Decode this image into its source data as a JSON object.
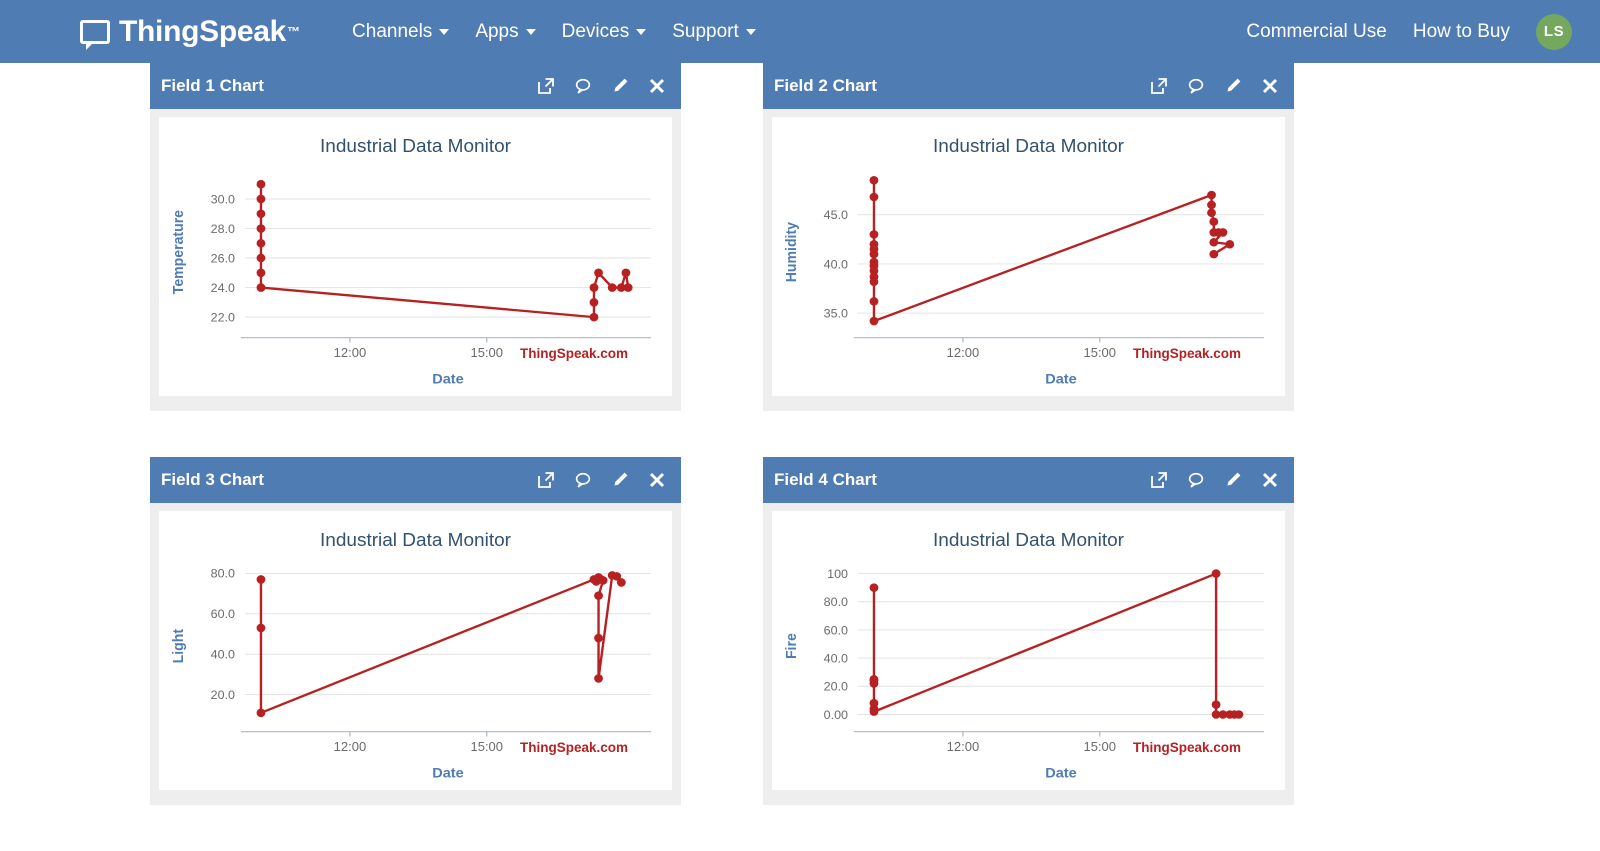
{
  "navbar": {
    "brand": "ThingSpeak",
    "brand_tm": "™",
    "brand_icon": "speech-screen-icon",
    "menu": [
      {
        "label": "Channels",
        "has_caret": true
      },
      {
        "label": "Apps",
        "has_caret": true
      },
      {
        "label": "Devices",
        "has_caret": true
      },
      {
        "label": "Support",
        "has_caret": true
      }
    ],
    "right": [
      {
        "label": "Commercial Use"
      },
      {
        "label": "How to Buy"
      }
    ],
    "avatar": {
      "initials": "LS",
      "color": "#74a85e"
    },
    "background": "#4f7cb3"
  },
  "panel_tools": {
    "export_label": "Open chart in new window",
    "comment_label": "Add annotation",
    "edit_label": "Edit chart",
    "close_label": "Close chart",
    "icons": [
      "external-link-icon",
      "comment-icon",
      "pencil-icon",
      "close-icon"
    ]
  },
  "panels": [
    {
      "title": "Field 1 Chart"
    },
    {
      "title": "Field 2 Chart"
    },
    {
      "title": "Field 3 Chart"
    },
    {
      "title": "Field 4 Chart"
    }
  ],
  "watermark": "ThingSpeak.com",
  "theme": {
    "panel_header": "#4f7cb3",
    "panel_body": "#eeeeee",
    "series_color": "#b72122",
    "axis_label_color": "#4f7cb3",
    "title_color": "#33526e",
    "tick_color": "#6b6b6b",
    "grid_color": "#e2e2e2"
  },
  "chart_data": [
    {
      "type": "scatter",
      "panel": "Field 1 Chart",
      "title": "Industrial Data Monitor",
      "xlabel": "Date",
      "ylabel": "Temperature",
      "xticks": [
        "12:00",
        "15:00"
      ],
      "xtick_values": [
        12.0,
        15.0
      ],
      "yticks": [
        "22.0",
        "24.0",
        "26.0",
        "28.0",
        "30.0"
      ],
      "ytick_values": [
        22,
        24,
        26,
        28,
        30
      ],
      "ylim": [
        21.2,
        31.6
      ],
      "xlim": [
        9.7,
        18.6
      ],
      "grid": true,
      "legend": "none",
      "watermark": "ThingSpeak.com",
      "series": [
        {
          "name": "Temperature",
          "points": [
            [
              10.05,
              31.0
            ],
            [
              10.05,
              30.0
            ],
            [
              10.05,
              29.0
            ],
            [
              10.05,
              28.0
            ],
            [
              10.05,
              27.0
            ],
            [
              10.05,
              26.0
            ],
            [
              10.05,
              25.0
            ],
            [
              10.05,
              24.0
            ],
            [
              17.35,
              22.0
            ],
            [
              17.35,
              23.0
            ],
            [
              17.35,
              24.0
            ],
            [
              17.45,
              25.0
            ],
            [
              17.75,
              24.0
            ],
            [
              17.95,
              24.0
            ],
            [
              18.05,
              25.0
            ],
            [
              18.1,
              24.0
            ]
          ]
        }
      ]
    },
    {
      "type": "scatter",
      "panel": "Field 2 Chart",
      "title": "Industrial Data Monitor",
      "xlabel": "Date",
      "ylabel": "Humidity",
      "xticks": [
        "12:00",
        "15:00"
      ],
      "xtick_values": [
        12.0,
        15.0
      ],
      "yticks": [
        "35.0",
        "40.0",
        "45.0"
      ],
      "ytick_values": [
        35,
        40,
        45
      ],
      "ylim": [
        33.4,
        49.0
      ],
      "xlim": [
        9.7,
        18.6
      ],
      "grid": true,
      "legend": "none",
      "watermark": "ThingSpeak.com",
      "series": [
        {
          "name": "Humidity",
          "points": [
            [
              10.05,
              48.5
            ],
            [
              10.05,
              46.8
            ],
            [
              10.05,
              43.0
            ],
            [
              10.05,
              42.0
            ],
            [
              10.05,
              41.5
            ],
            [
              10.05,
              41.0
            ],
            [
              10.05,
              40.2
            ],
            [
              10.05,
              39.8
            ],
            [
              10.05,
              39.3
            ],
            [
              10.05,
              38.7
            ],
            [
              10.05,
              38.2
            ],
            [
              10.05,
              36.2
            ],
            [
              10.05,
              34.2
            ],
            [
              17.45,
              47.0
            ],
            [
              17.45,
              46.0
            ],
            [
              17.45,
              45.2
            ],
            [
              17.5,
              44.3
            ],
            [
              17.5,
              43.2
            ],
            [
              17.6,
              43.2
            ],
            [
              17.7,
              43.2
            ],
            [
              17.5,
              42.2
            ],
            [
              17.85,
              42.0
            ],
            [
              17.5,
              41.0
            ]
          ]
        }
      ]
    },
    {
      "type": "scatter",
      "panel": "Field 3 Chart",
      "title": "Industrial Data Monitor",
      "xlabel": "Date",
      "ylabel": "Light",
      "xticks": [
        "12:00",
        "15:00"
      ],
      "xtick_values": [
        12.0,
        15.0
      ],
      "yticks": [
        "20.0",
        "40.0",
        "60.0",
        "80.0"
      ],
      "ytick_values": [
        20,
        40,
        60,
        80
      ],
      "ylim": [
        6.0,
        82.0
      ],
      "xlim": [
        9.7,
        18.6
      ],
      "grid": true,
      "legend": "none",
      "watermark": "ThingSpeak.com",
      "series": [
        {
          "name": "Light",
          "points": [
            [
              10.05,
              77.0
            ],
            [
              10.05,
              53.0
            ],
            [
              10.05,
              11.0
            ],
            [
              17.35,
              77.0
            ],
            [
              17.4,
              76.0
            ],
            [
              17.45,
              78.0
            ],
            [
              17.5,
              77.0
            ],
            [
              17.55,
              76.5
            ],
            [
              17.45,
              69.0
            ],
            [
              17.45,
              48.0
            ],
            [
              17.45,
              28.0
            ],
            [
              17.75,
              79.0
            ],
            [
              17.85,
              78.5
            ],
            [
              17.95,
              75.5
            ]
          ]
        }
      ]
    },
    {
      "type": "scatter",
      "panel": "Field 4 Chart",
      "title": "Industrial Data Monitor",
      "xlabel": "Date",
      "ylabel": "Fire",
      "xticks": [
        "12:00",
        "15:00"
      ],
      "xtick_values": [
        12.0,
        15.0
      ],
      "yticks": [
        "0.00",
        "20.0",
        "40.0",
        "60.0",
        "80.0",
        "100"
      ],
      "ytick_values": [
        0,
        20,
        40,
        60,
        80,
        100
      ],
      "ylim": [
        -6.0,
        103.0
      ],
      "xlim": [
        9.7,
        18.6
      ],
      "grid": true,
      "legend": "none",
      "watermark": "ThingSpeak.com",
      "series": [
        {
          "name": "Fire",
          "points": [
            [
              10.05,
              90.0
            ],
            [
              10.05,
              25.0
            ],
            [
              10.05,
              24.0
            ],
            [
              10.05,
              22.0
            ],
            [
              10.05,
              8.0
            ],
            [
              10.05,
              4.0
            ],
            [
              10.05,
              2.0
            ],
            [
              17.55,
              100.0
            ],
            [
              17.55,
              7.0
            ],
            [
              17.55,
              0.0
            ],
            [
              17.7,
              0.0
            ],
            [
              17.85,
              0.0
            ],
            [
              17.95,
              0.0
            ],
            [
              18.05,
              0.0
            ]
          ]
        }
      ]
    }
  ]
}
